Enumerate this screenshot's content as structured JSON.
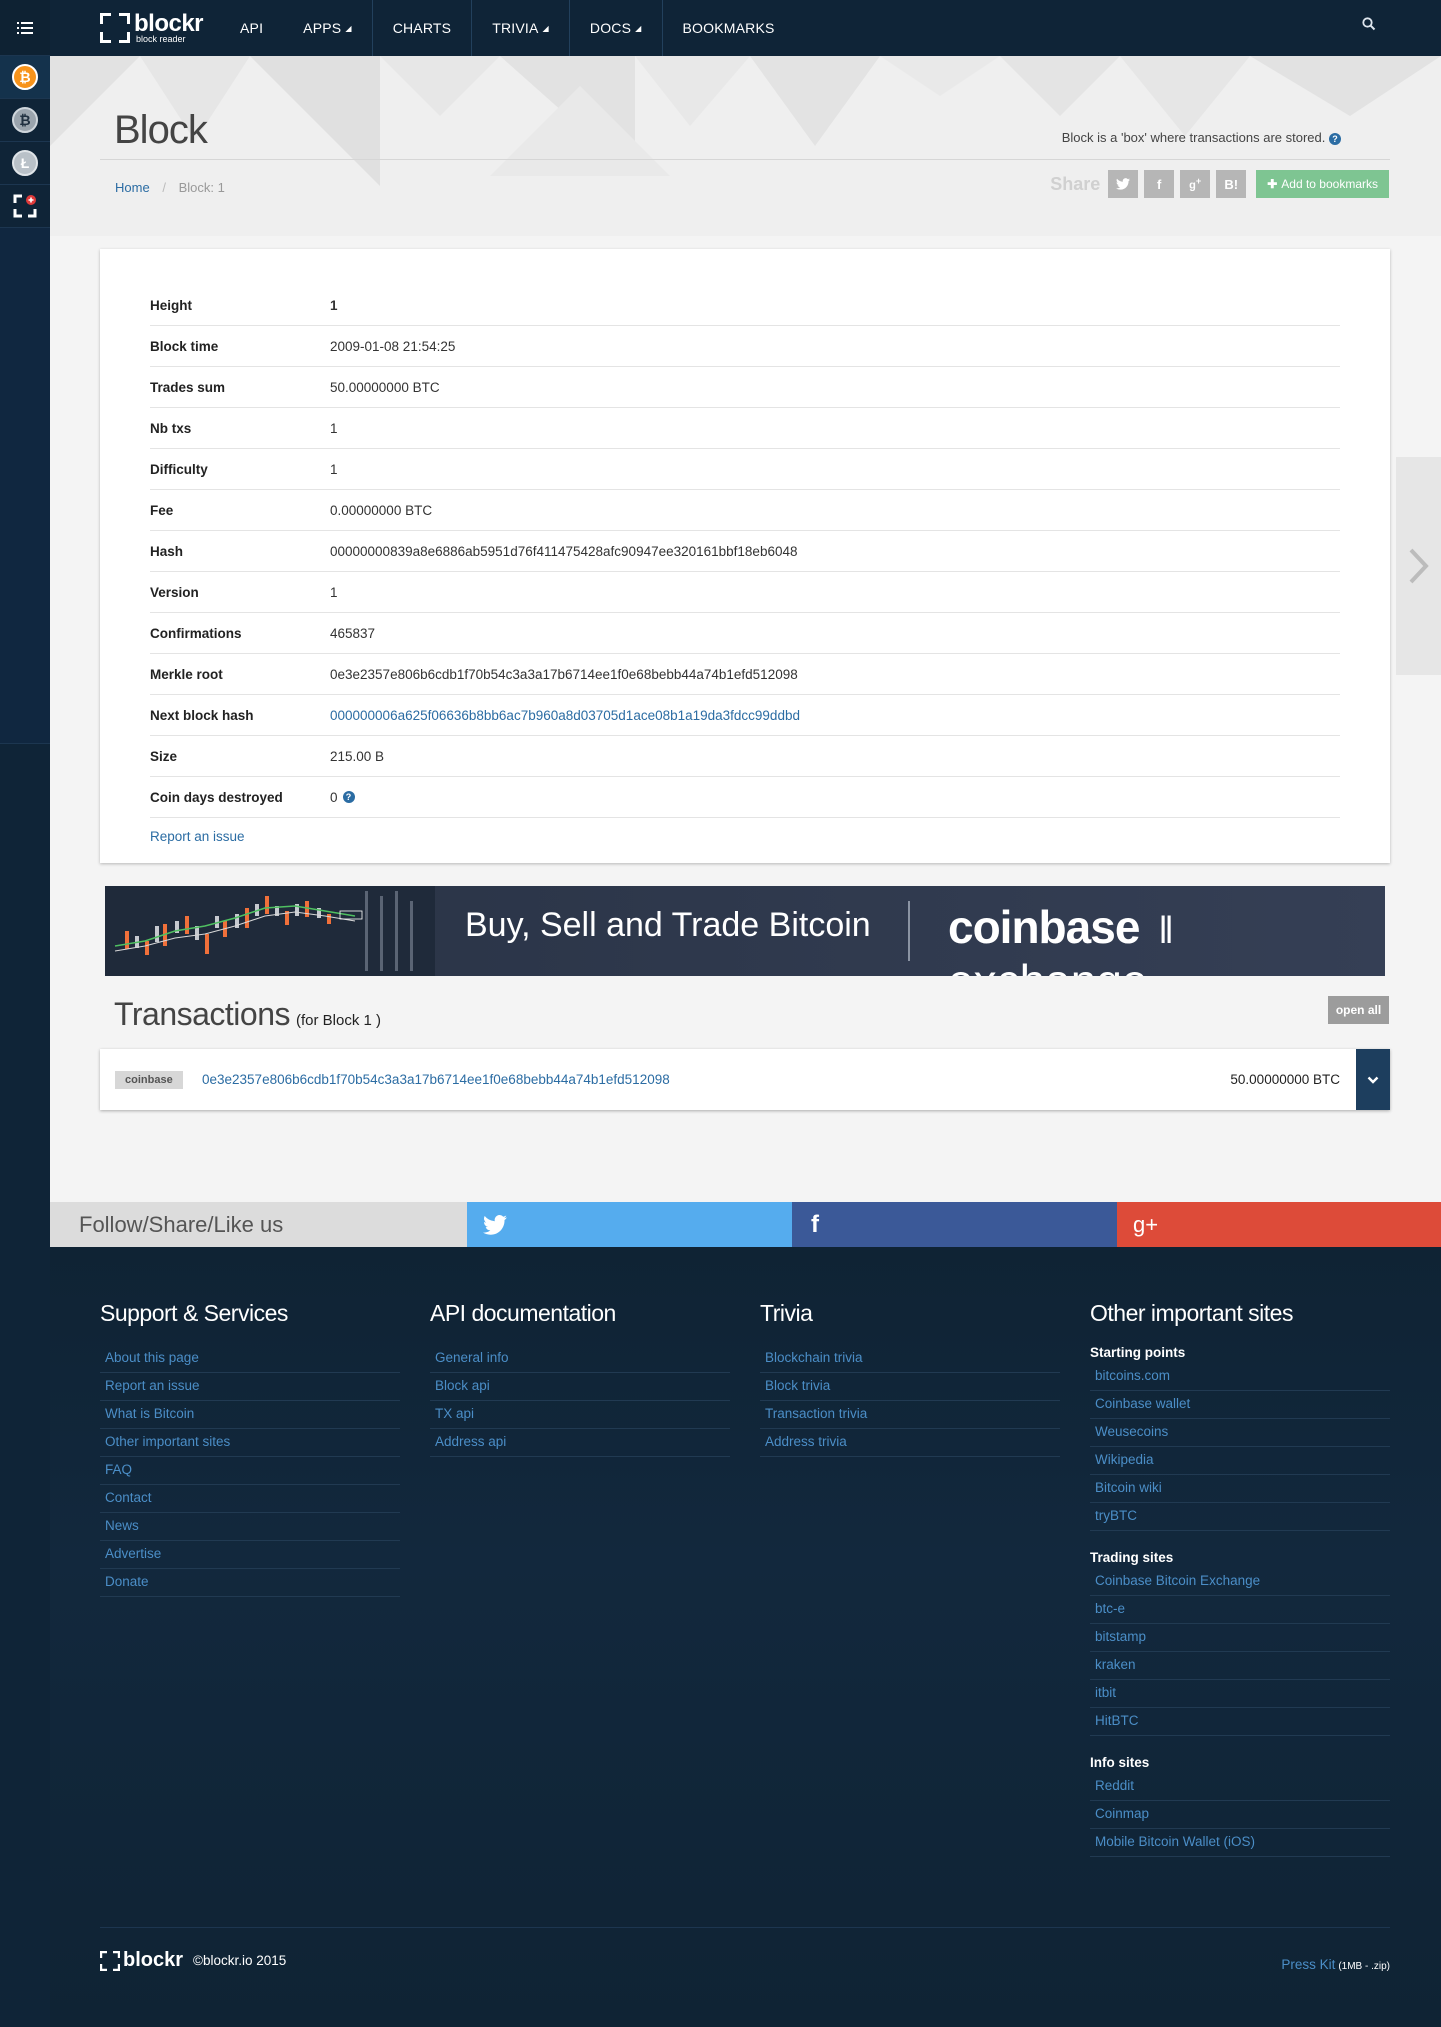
{
  "nav": {
    "logo_text": "blockr",
    "logo_subtext": "block reader",
    "items": [
      {
        "label": "API",
        "dropdown": false
      },
      {
        "label": "APPS",
        "dropdown": true
      },
      {
        "label": "CHARTS",
        "dropdown": false
      },
      {
        "label": "TRIVIA",
        "dropdown": true
      },
      {
        "label": "DOCS",
        "dropdown": true
      },
      {
        "label": "BOOKMARKS",
        "dropdown": false
      }
    ],
    "search_icon": "search-icon"
  },
  "sidebar": {
    "menu_icon": "list-icon",
    "items": [
      {
        "name": "bitcoin",
        "glyph": "₿"
      },
      {
        "name": "gear-coin",
        "glyph": "₿"
      },
      {
        "name": "litecoin",
        "glyph": "Ł"
      },
      {
        "name": "blockr-add",
        "glyph": "+"
      }
    ]
  },
  "header": {
    "title": "Block",
    "description": "Block is a 'box' where transactions are stored.",
    "breadcrumb_home": "Home",
    "breadcrumb_current": "Block: 1",
    "share_label": "Share",
    "share_buttons": [
      "twitter",
      "facebook",
      "google-plus",
      "hatena"
    ],
    "bookmark_label": "Add to bookmarks"
  },
  "block": {
    "rows": [
      {
        "label": "Height",
        "value": "1"
      },
      {
        "label": "Block time",
        "value": "2009-01-08 21:54:25"
      },
      {
        "label": "Trades sum",
        "value": "50.00000000 BTC"
      },
      {
        "label": "Nb txs",
        "value": "1"
      },
      {
        "label": "Difficulty",
        "value": "1"
      },
      {
        "label": "Fee",
        "value": "0.00000000 BTC"
      },
      {
        "label": "Hash",
        "value": "00000000839a8e6886ab5951d76f411475428afc90947ee320161bbf18eb6048"
      },
      {
        "label": "Version",
        "value": "1"
      },
      {
        "label": "Confirmations",
        "value": "465837"
      },
      {
        "label": "Merkle root",
        "value": "0e3e2357e806b6cdb1f70b54c3a3a17b6714ee1f0e68bebb44a74b1efd512098"
      },
      {
        "label": "Next block hash",
        "value": "000000006a625f06636b8bb6ac7b960a8d03705d1ace08b1a19da3fdcc99ddbd"
      },
      {
        "label": "Size",
        "value": "215.00 B"
      },
      {
        "label": "Coin days destroyed",
        "value": "0"
      }
    ],
    "report_link": "Report an issue"
  },
  "ad": {
    "text": "Buy, Sell and Trade Bitcoin",
    "brand_bold": "coinbase",
    "brand_light": "exchange"
  },
  "transactions": {
    "title": "Transactions",
    "subtitle": "(for Block 1 )",
    "open_all": "open all",
    "items": [
      {
        "tag": "coinbase",
        "hash": "0e3e2357e806b6cdb1f70b54c3a3a17b6714ee1f0e68bebb44a74b1efd512098",
        "amount": "50.00000000 BTC"
      }
    ]
  },
  "social": {
    "follow_text": "Follow/Share/Like us",
    "gplus_glyph": "g+",
    "facebook_glyph": "f"
  },
  "footer": {
    "support": {
      "title": "Support & Services",
      "links": [
        "About this page",
        "Report an issue",
        "What is Bitcoin",
        "Other important sites",
        "FAQ",
        "Contact",
        "News",
        "Advertise",
        "Donate"
      ]
    },
    "api": {
      "title": "API documentation",
      "links": [
        "General info",
        "Block api",
        "TX api",
        "Address api"
      ]
    },
    "trivia": {
      "title": "Trivia",
      "links": [
        "Blockchain trivia",
        "Block trivia",
        "Transaction trivia",
        "Address trivia"
      ]
    },
    "other": {
      "title": "Other important sites",
      "groups": [
        {
          "title": "Starting points",
          "links": [
            "bitcoins.com",
            "Coinbase wallet",
            "Weusecoins",
            "Wikipedia",
            "Bitcoin wiki",
            "tryBTC"
          ]
        },
        {
          "title": "Trading sites",
          "links": [
            "Coinbase Bitcoin Exchange",
            "btc-e",
            "bitstamp",
            "kraken",
            "itbit",
            "HitBTC"
          ]
        },
        {
          "title": "Info sites",
          "links": [
            "Reddit",
            "Coinmap",
            "Mobile Bitcoin Wallet (iOS)"
          ]
        }
      ]
    },
    "logo_text": "blockr",
    "copyright": "©blockr.io 2015",
    "press_kit": "Press Kit",
    "press_kit_size": "(1MB - .zip)"
  }
}
